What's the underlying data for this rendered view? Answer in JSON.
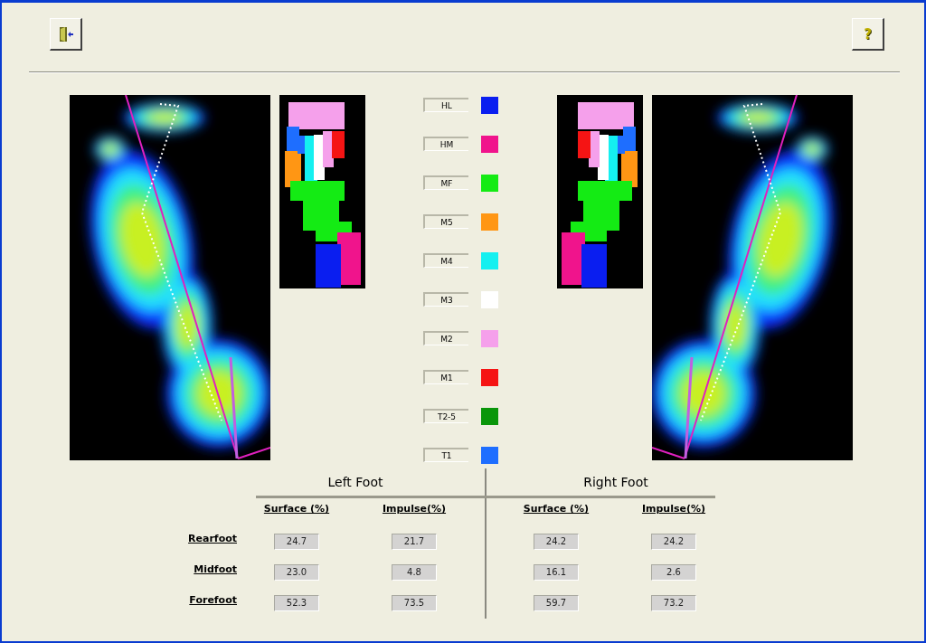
{
  "toolbar": {
    "buttons": [
      {
        "kind": "exit"
      },
      {
        "kind": "help",
        "label": "?"
      }
    ]
  },
  "legend": [
    {
      "label": "HL",
      "color": "#0a1ef0"
    },
    {
      "label": "HM",
      "color": "#f0148c"
    },
    {
      "label": "MF",
      "color": "#14eb14"
    },
    {
      "label": "M5",
      "color": "#ff9614"
    },
    {
      "label": "M4",
      "color": "#14f0f0"
    },
    {
      "label": "M3",
      "color": "#ffffff"
    },
    {
      "label": "M2",
      "color": "#f5a0eb"
    },
    {
      "label": "M1",
      "color": "#f51414"
    },
    {
      "label": "T2-5",
      "color": "#0a960a"
    },
    {
      "label": "T1",
      "color": "#1e6eff"
    }
  ],
  "table": {
    "groups": [
      "Left Foot",
      "Right Foot"
    ],
    "columns": [
      "Surface (%)",
      "Impulse(%)",
      "Surface (%)",
      "Impulse(%)"
    ],
    "rows": [
      {
        "label": "Rearfoot",
        "values": [
          "24.7",
          "21.7",
          "24.2",
          "24.2"
        ]
      },
      {
        "label": "Midfoot",
        "values": [
          "23.0",
          "4.8",
          "16.1",
          "2.6"
        ]
      },
      {
        "label": "Forefoot",
        "values": [
          "52.3",
          "73.5",
          "59.7",
          "73.2"
        ]
      }
    ]
  }
}
